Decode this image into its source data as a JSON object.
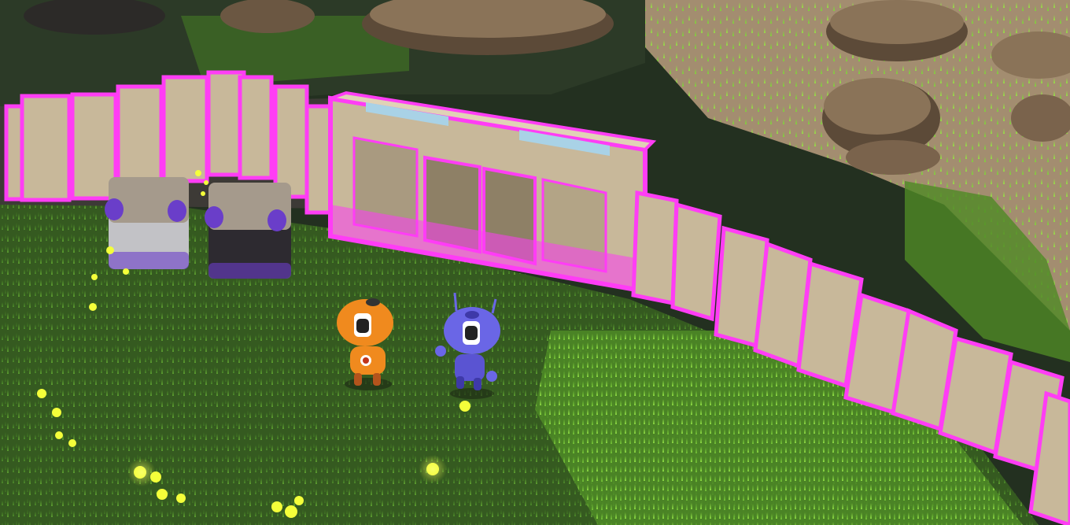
{
  "scene": {
    "description_name": "isometric-garden-scene",
    "colors": {
      "grass_dark": "#2f4a1f",
      "grass_mid": "#3f6a25",
      "grass_light": "#7fd43a",
      "ground_shadow": "#2a3527",
      "dirt": "#a38d70",
      "rock": "#8a7358",
      "rock_dark": "#5c4a38",
      "fence_panel": "#c8b89a",
      "fence_trim": "#ff3df5",
      "gate_glass": "#a9d2e6",
      "crate_body": "#c2c2c6",
      "crate_lid": "#a59a8c",
      "crate_cap": "#6a3ec9",
      "orange_robot": "#f08a1e",
      "blue_robot": "#6a66e6",
      "firefly": "#f4ff3a"
    },
    "characters": [
      {
        "name": "orange-robot",
        "role": "player-companion"
      },
      {
        "name": "blue-robot",
        "role": "player"
      }
    ],
    "props": [
      "fence",
      "gate",
      "crate-left",
      "crate-right",
      "rocks",
      "fireflies"
    ]
  }
}
